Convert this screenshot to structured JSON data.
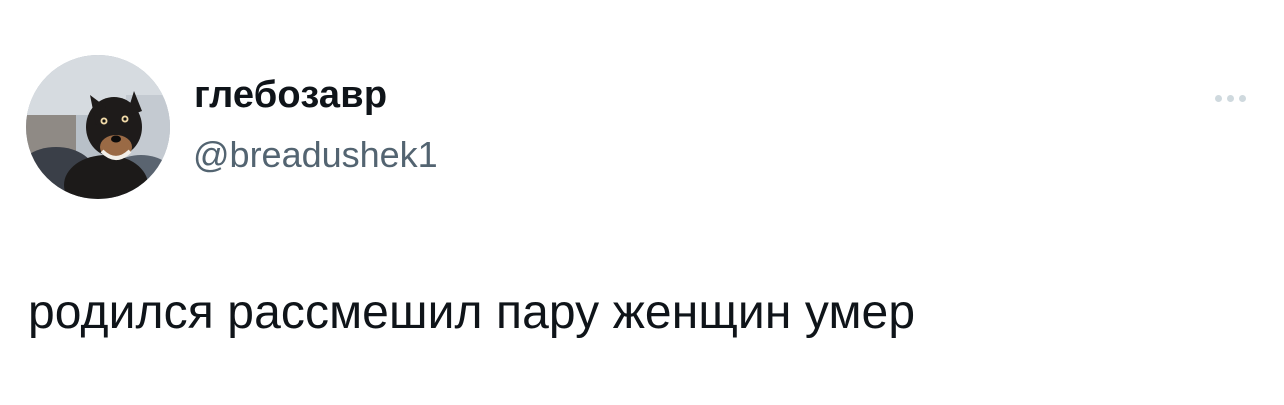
{
  "user": {
    "display_name": "глебозавр",
    "handle": "@breadushek1",
    "avatar": "dog-photo-avatar"
  },
  "tweet": {
    "text": "родился рассмешил пару женщин умер"
  },
  "actions": {
    "more_icon": "more-horizontal-icon"
  },
  "colors": {
    "text_primary": "#0f1419",
    "text_secondary": "#536471",
    "more_dots": "#cfd9de",
    "background": "#ffffff"
  }
}
